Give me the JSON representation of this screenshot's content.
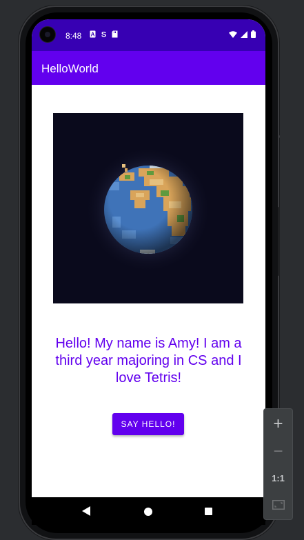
{
  "status_bar": {
    "time": "8:48",
    "left_icons": [
      "a-icon",
      "s-icon",
      "sd-card-icon"
    ],
    "right_icons": [
      "wifi-icon",
      "signal-icon",
      "battery-icon"
    ]
  },
  "app_bar": {
    "title": "HelloWorld"
  },
  "main": {
    "image": {
      "icon": "pixel-earth-image"
    },
    "hello_text": "Hello! My name is Amy! I am a third year majoring in CS and I love Tetris!",
    "button_label": "SAY HELLO!"
  },
  "nav_bar": {
    "icons": [
      "back-icon",
      "home-icon",
      "recents-icon"
    ]
  },
  "zoom_panel": {
    "zoom_in": "+",
    "zoom_out": "−",
    "actual_size": "1:1",
    "fit_icon": "fit-screen-icon"
  },
  "colors": {
    "status_bar": "#3700b3",
    "app_bar": "#6200ee",
    "accent_text": "#6200ee",
    "button": "#6200ee"
  }
}
